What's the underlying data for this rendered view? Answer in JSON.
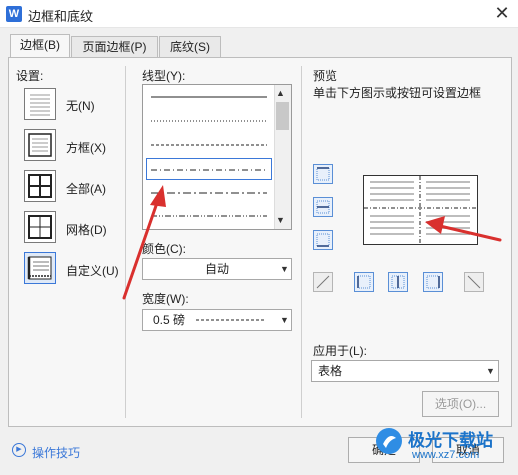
{
  "window": {
    "title": "边框和底纹",
    "app_icon_letter": "W",
    "close_glyph": "✕"
  },
  "tabs": [
    {
      "label": "边框(B)",
      "active": true
    },
    {
      "label": "页面边框(P)",
      "active": false
    },
    {
      "label": "底纹(S)",
      "active": false
    }
  ],
  "settings": {
    "label": "设置:",
    "items": [
      {
        "label": "无(N)"
      },
      {
        "label": "方框(X)"
      },
      {
        "label": "全部(A)"
      },
      {
        "label": "网格(D)"
      },
      {
        "label": "自定义(U)",
        "selected": true
      }
    ]
  },
  "line_style": {
    "label": "线型(Y):",
    "selected_index": 3
  },
  "color": {
    "label": "颜色(C):",
    "value": "自动"
  },
  "width": {
    "label": "宽度(W):",
    "value": "0.5  磅"
  },
  "preview": {
    "label": "预览",
    "hint": "单击下方图示或按钮可设置边框"
  },
  "apply_to": {
    "label": "应用于(L):",
    "value": "表格"
  },
  "options_button": "选项(O)...",
  "tips_link": "操作技巧",
  "ok_button": "确定",
  "cancel_button": "取消",
  "watermark": {
    "text": "极光下载站",
    "url": "www.xz7.com"
  },
  "colors": {
    "accent": "#3b78d8",
    "arrow": "#d9302e"
  }
}
